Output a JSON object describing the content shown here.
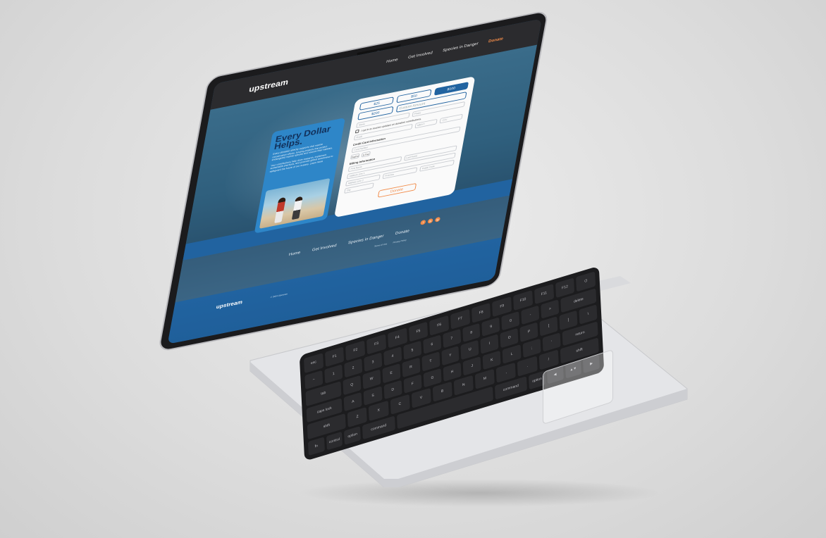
{
  "site": {
    "logo": "upstream",
    "nav": [
      "Home",
      "Get Involved",
      "Species in Danger",
      "Donate"
    ],
    "active_nav": "Donate"
  },
  "hero_card": {
    "title": "Every Dollar Helps.",
    "text1": "Every donation directly supports vital marine conservation efforts, funding projects that protect endangered marine species and restore their habitats.",
    "text2": "Your contributions help drive research, implement sustainable practices, and promote global awareness to safeguard the future of our oceans. Learn More"
  },
  "form": {
    "amounts": [
      "$25",
      "$50",
      "$100",
      "$200"
    ],
    "selected_amount": "$100",
    "custom_amount_placeholder": "Custom Amount",
    "first_name": "Name",
    "phone": "Phone",
    "optin_label": "I opt in to receive updates on donation contributions.",
    "email": "Email",
    "mmyy": "MM/YY",
    "cvv": "CVV",
    "credit_card_section": "Credit Card Information",
    "card_number": "Card Number",
    "paypal": "PayPal",
    "gpay": "G Pay",
    "billing_section": "Billing Information",
    "billing_first": "First Name",
    "billing_last": "Last Name",
    "address1": "Address Line 1",
    "address2": "Address Line 2",
    "province": "Province",
    "postal": "Postal Code",
    "city": "City",
    "donate_button": "Donate"
  },
  "footer": {
    "links": [
      "Home",
      "Get Involved",
      "Species in Danger",
      "Donate"
    ],
    "logo": "upstream",
    "copyright": "© 2024 Upstream",
    "legal": [
      "Terms of Use",
      "Privacy Policy"
    ],
    "socials": [
      "f",
      "in",
      "ig"
    ]
  },
  "colors": {
    "accent_orange": "#f28c4a",
    "brand_blue": "#2163a0",
    "nav_dark": "#2b2b2e",
    "card_blue": "#2e86c8"
  },
  "keyboard": {
    "rows": [
      [
        "esc",
        "F1",
        "F2",
        "F3",
        "F4",
        "F5",
        "F6",
        "F7",
        "F8",
        "F9",
        "F10",
        "F11",
        "F12",
        "⏻"
      ],
      [
        "~",
        "1",
        "2",
        "3",
        "4",
        "5",
        "6",
        "7",
        "8",
        "9",
        "0",
        "-",
        "=",
        "delete"
      ],
      [
        "tab",
        "Q",
        "W",
        "E",
        "R",
        "T",
        "Y",
        "U",
        "I",
        "O",
        "P",
        "[",
        "]",
        "\\"
      ],
      [
        "caps lock",
        "A",
        "S",
        "D",
        "F",
        "G",
        "H",
        "J",
        "K",
        "L",
        ";",
        "'",
        "return"
      ],
      [
        "shift",
        "Z",
        "X",
        "C",
        "V",
        "B",
        "N",
        "M",
        ",",
        ".",
        "/",
        "shift"
      ],
      [
        "fn",
        "control",
        "option",
        "command",
        "",
        "command",
        "option",
        "◀",
        "▲▼",
        "▶"
      ]
    ]
  }
}
